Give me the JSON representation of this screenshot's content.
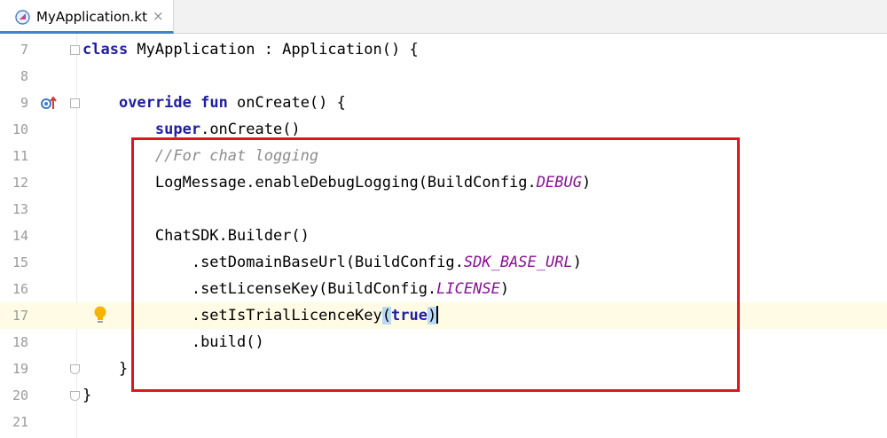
{
  "tab": {
    "title": "MyApplication.kt",
    "close": "×",
    "icon": "kotlin-file-icon"
  },
  "editor": {
    "current_line": "17",
    "lines": [
      {
        "num": "7"
      },
      {
        "num": "8"
      },
      {
        "num": "9"
      },
      {
        "num": "10"
      },
      {
        "num": "11"
      },
      {
        "num": "12"
      },
      {
        "num": "13"
      },
      {
        "num": "14"
      },
      {
        "num": "15"
      },
      {
        "num": "16"
      },
      {
        "num": "17"
      },
      {
        "num": "18"
      },
      {
        "num": "19"
      },
      {
        "num": "20"
      },
      {
        "num": "21"
      }
    ],
    "code": {
      "l7": {
        "kw": "class",
        "rest": " MyApplication : Application() {"
      },
      "l9": {
        "indent": "    ",
        "kw1": "override",
        "sp": " ",
        "kw2": "fun",
        "rest": " onCreate() {"
      },
      "l10": {
        "indent": "        ",
        "kw": "super",
        "rest": ".onCreate()"
      },
      "l11": {
        "indent": "        ",
        "comment": "//For chat logging"
      },
      "l12": {
        "indent": "        ",
        "a": "LogMessage.enableDebugLogging(BuildConfig.",
        "st": "DEBUG",
        "b": ")"
      },
      "l14": {
        "indent": "        ",
        "text": "ChatSDK.Builder()"
      },
      "l15": {
        "indent": "            ",
        "a": ".setDomainBaseUrl(BuildConfig.",
        "st": "SDK_BASE_URL",
        "b": ")"
      },
      "l16": {
        "indent": "            ",
        "a": ".setLicenseKey(BuildConfig.",
        "st": "LICENSE",
        "b": ")"
      },
      "l17": {
        "indent": "            ",
        "a": ".setIsTrialLicenceKey",
        "open": "(",
        "kw": "true",
        "close": ")"
      },
      "l18": {
        "indent": "            ",
        "text": ".build()"
      },
      "l19": {
        "indent": "    ",
        "text": "}"
      },
      "l20": {
        "text": "}"
      }
    }
  },
  "colors": {
    "keyword": "#1f1fa0",
    "comment": "#8c8c8c",
    "static_field": "#871094",
    "highlight_box": "#e0151f",
    "current_line": "#fffbe5"
  },
  "icons": [
    "kotlin-file-icon",
    "override-method-icon",
    "lightbulb-icon",
    "fold-icon"
  ]
}
